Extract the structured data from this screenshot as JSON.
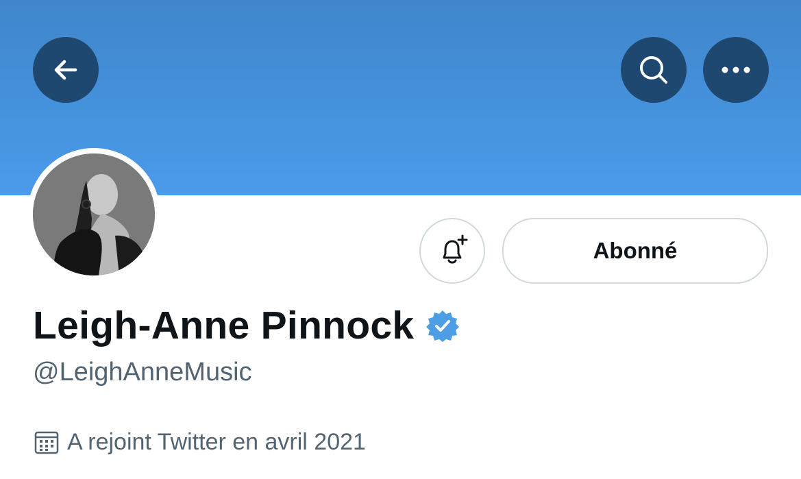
{
  "header": {
    "back_icon": "arrow-left-icon",
    "search_icon": "search-icon",
    "more_icon": "more-horizontal-icon",
    "banner_color": "#4a9bea",
    "button_bg_color": "#1f4870"
  },
  "profile": {
    "display_name": "Leigh-Anne Pinnock",
    "handle": "@LeighAnneMusic",
    "verified": true,
    "verified_color": "#1d9bf0",
    "joined_text": "A rejoint Twitter en avril 2021",
    "joined_icon": "calendar-icon"
  },
  "actions": {
    "notify_icon": "bell-plus-icon",
    "follow_label": "Abonné"
  }
}
